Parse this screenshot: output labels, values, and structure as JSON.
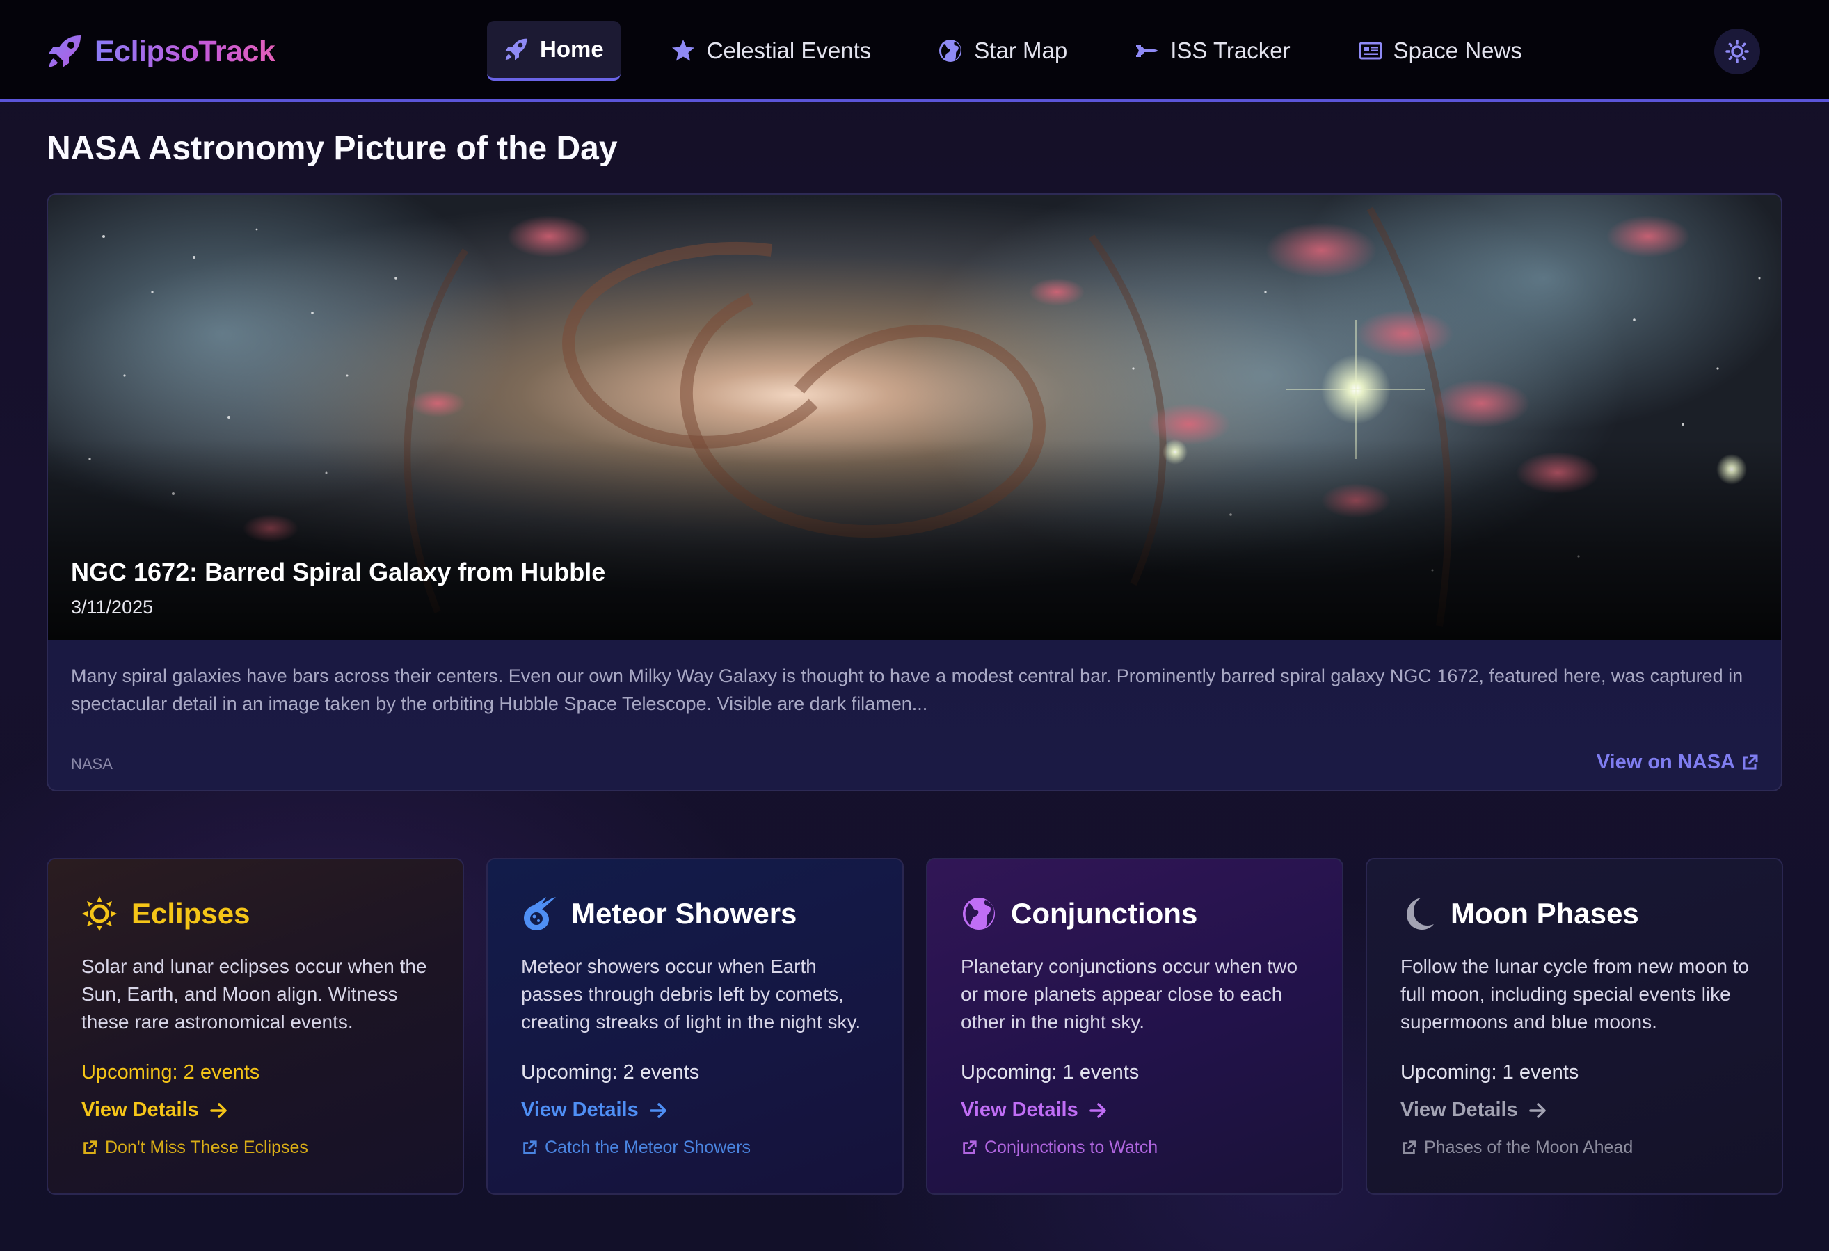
{
  "brand": {
    "name": "EclipsoTrack",
    "icon": "rocket-icon"
  },
  "nav": {
    "items": [
      {
        "label": "Home",
        "icon": "rocket-icon",
        "active": true
      },
      {
        "label": "Celestial Events",
        "icon": "star-icon",
        "active": false
      },
      {
        "label": "Star Map",
        "icon": "globe-icon",
        "active": false
      },
      {
        "label": "ISS Tracker",
        "icon": "satellite-icon",
        "active": false
      },
      {
        "label": "Space News",
        "icon": "newspaper-icon",
        "active": false
      }
    ],
    "theme_toggle_icon": "sun-icon"
  },
  "apod": {
    "section_title": "NASA Astronomy Picture of the Day",
    "title": "NGC 1672: Barred Spiral Galaxy from Hubble",
    "date": "3/11/2025",
    "description": "Many spiral galaxies have bars across their centers. Even our own Milky Way Galaxy is thought to have a modest central bar. Prominently barred spiral galaxy NGC 1672, featured here, was captured in spectacular detail in an image taken by the orbiting Hubble Space Telescope. Visible are dark filamen...",
    "credit": "NASA",
    "link_label": "View on NASA"
  },
  "cards": [
    {
      "title": "Eclipses",
      "icon": "sun-icon",
      "text": "Solar and lunar eclipses occur when the Sun, Earth, and Moon align. Witness these rare astronomical events.",
      "upcoming": "Upcoming: 2 events",
      "view_details": "View Details",
      "external_link": "Don't Miss These Eclipses",
      "accent": "#f5c518"
    },
    {
      "title": "Meteor Showers",
      "icon": "meteor-icon",
      "text": "Meteor showers occur when Earth passes through debris left by comets, creating streaks of light in the night sky.",
      "upcoming": "Upcoming: 2 events",
      "view_details": "View Details",
      "external_link": "Catch the Meteor Showers",
      "accent": "#4f8ff5"
    },
    {
      "title": "Conjunctions",
      "icon": "globe-icon",
      "text": "Planetary conjunctions occur when two or more planets appear close to each other in the night sky.",
      "upcoming": "Upcoming: 1 events",
      "view_details": "View Details",
      "external_link": "Conjunctions to Watch",
      "accent": "#c06ef5"
    },
    {
      "title": "Moon Phases",
      "icon": "moon-icon",
      "text": "Follow the lunar cycle from new moon to full moon, including special events like supermoons and blue moons.",
      "upcoming": "Upcoming: 1 events",
      "view_details": "View Details",
      "external_link": "Phases of the Moon Ahead",
      "accent": "#a3a3b3"
    }
  ]
}
